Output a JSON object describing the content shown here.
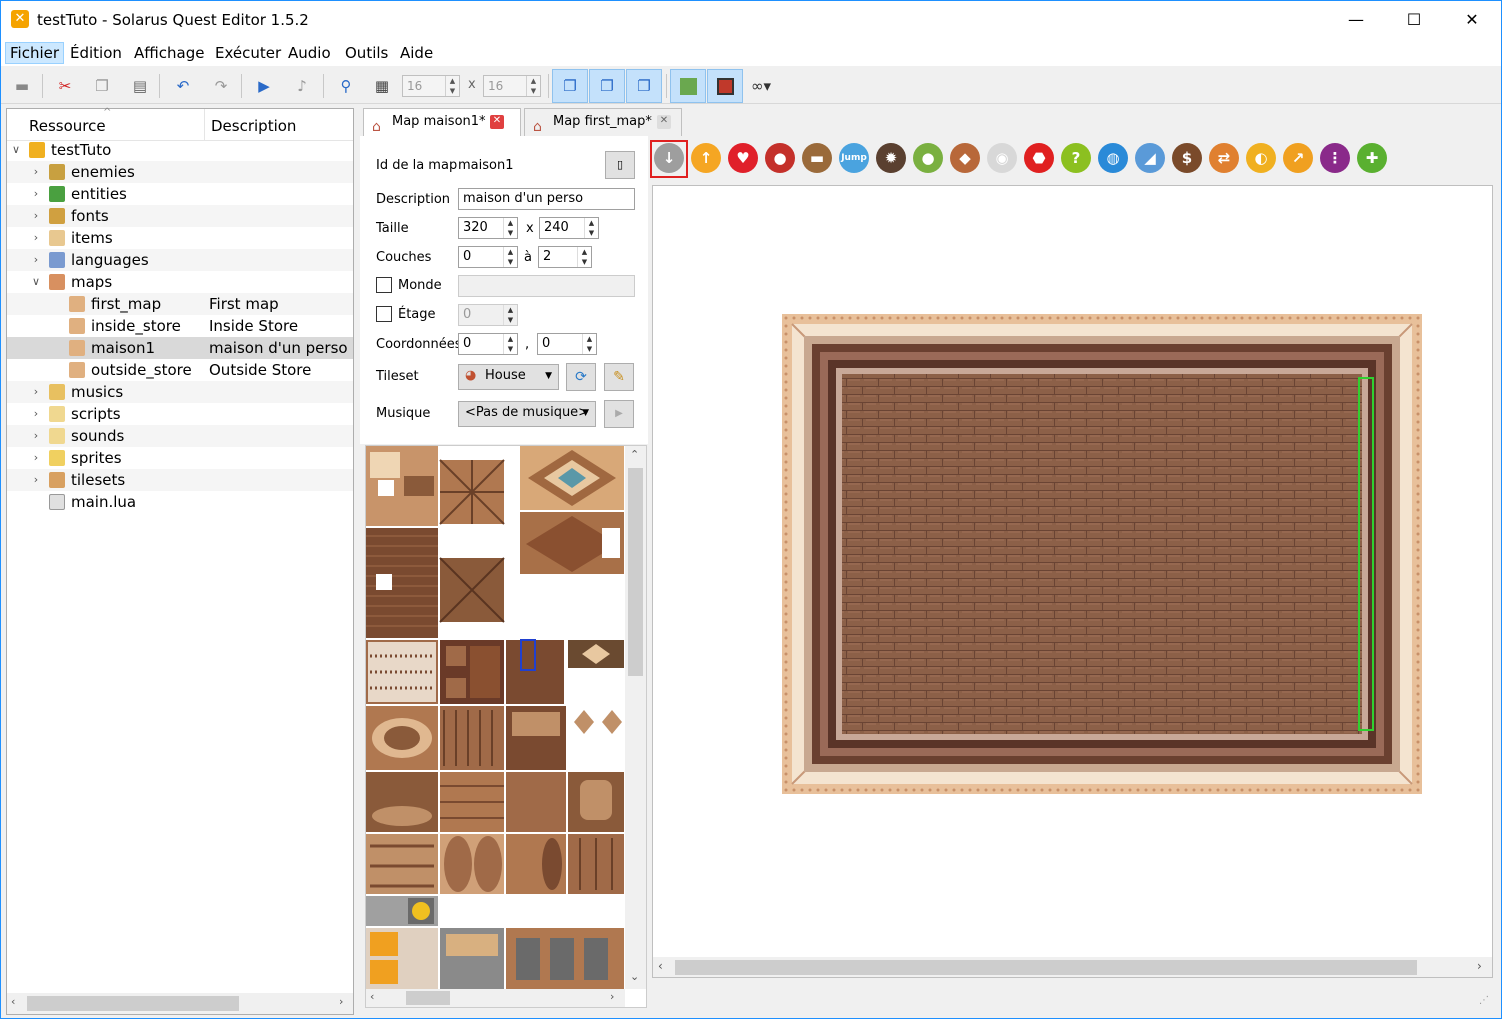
{
  "window": {
    "title": "testTuto - Solarus Quest Editor 1.5.2",
    "minimize": "—",
    "maximize": "☐",
    "close": "✕"
  },
  "menu": [
    "Fichier",
    "Édition",
    "Affichage",
    "Exécuter",
    "Audio",
    "Outils",
    "Aide"
  ],
  "toolbar": {
    "grid_width": "16",
    "grid_height": "16",
    "grid_sep": "x",
    "icons": [
      "save-icon",
      "cut-icon",
      "copy-icon",
      "paste-icon",
      "undo-icon",
      "redo-icon",
      "run-icon",
      "music-icon",
      "zoom-icon",
      "grid-icon",
      "layer-0-icon",
      "layer-1-icon",
      "layer-2-icon",
      "show-traversable-icon",
      "show-obstacle-icon",
      "link-icon"
    ]
  },
  "resource_tree": {
    "col_resource": "Ressource",
    "col_description": "Description",
    "root": "testTuto",
    "items": [
      {
        "name": "enemies",
        "desc": ""
      },
      {
        "name": "entities",
        "desc": ""
      },
      {
        "name": "fonts",
        "desc": ""
      },
      {
        "name": "items",
        "desc": ""
      },
      {
        "name": "languages",
        "desc": ""
      },
      {
        "name": "maps",
        "desc": ""
      },
      {
        "name": "first_map",
        "desc": "First map"
      },
      {
        "name": "inside_store",
        "desc": "Inside Store"
      },
      {
        "name": "maison1",
        "desc": "maison d'un perso"
      },
      {
        "name": "outside_store",
        "desc": "Outside Store"
      },
      {
        "name": "musics",
        "desc": ""
      },
      {
        "name": "scripts",
        "desc": ""
      },
      {
        "name": "sounds",
        "desc": ""
      },
      {
        "name": "sprites",
        "desc": ""
      },
      {
        "name": "tilesets",
        "desc": ""
      },
      {
        "name": "main.lua",
        "desc": ""
      }
    ]
  },
  "tabs": [
    {
      "label": "Map maison1*",
      "active": true
    },
    {
      "label": "Map first_map*",
      "active": false
    }
  ],
  "map_properties": {
    "id_label": "Id de la map",
    "id_value": "maison1",
    "description_label": "Description",
    "description_value": "maison d'un perso",
    "size_label": "Taille",
    "size_w": "320",
    "size_x": "x",
    "size_h": "240",
    "layers_label": "Couches",
    "layers_min": "0",
    "layers_to": "à",
    "layers_max": "2",
    "world_label": "Monde",
    "world_value": "",
    "floor_label": "Étage",
    "floor_value": "0",
    "coords_label": "Coordonnées",
    "coord_x": "0",
    "coord_sep": ",",
    "coord_y": "0",
    "tileset_label": "Tileset",
    "tileset_value": "House",
    "music_label": "Musique",
    "music_value": "<Pas de musique>"
  },
  "entity_toolbar": {
    "jump_label": "Jump",
    "icons": [
      "destination-icon",
      "teletransporter-icon",
      "pickable-icon",
      "destructible-icon",
      "chest-icon",
      "jumper-icon",
      "enemy-icon",
      "npc-icon",
      "block-icon",
      "switch-icon",
      "wall-icon",
      "sensor-icon",
      "crystal-icon",
      "crystal-block-icon",
      "shop-treasure-icon",
      "stream-icon",
      "door-icon",
      "stairs-icon",
      "separator-icon",
      "custom-entity-icon"
    ],
    "colors": [
      "#9e9e9e",
      "#f5a623",
      "#e0202a",
      "#c4302a",
      "#9a6a3a",
      "#4aa3df",
      "#5a4030",
      "#7ab040",
      "#b8683a",
      "#d8d8d8",
      "#e02020",
      "#8cc020",
      "#2a8ad8",
      "#5a9ad8",
      "#7a4a2a",
      "#e08030",
      "#f0b020",
      "#f0a020",
      "#8a2a8a",
      "#5ab030"
    ]
  }
}
